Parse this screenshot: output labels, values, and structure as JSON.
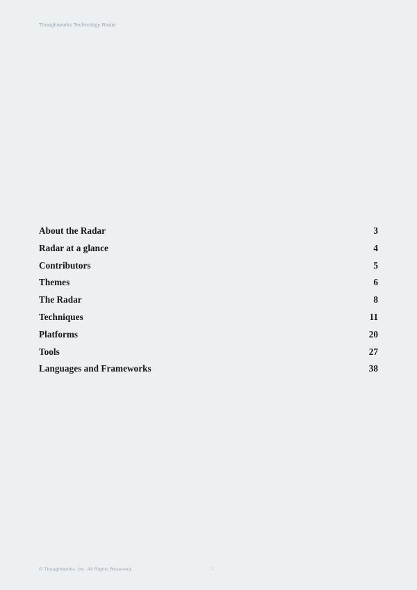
{
  "document": {
    "running_header": "Thoughtworks Technology Radar",
    "background_color": "#edf0f3",
    "text_color": "#13161a",
    "muted_color": "#9aa3ad"
  },
  "toc": {
    "entries": [
      {
        "title": "About the Radar",
        "page": "3"
      },
      {
        "title": "Radar at a glance",
        "page": "4"
      },
      {
        "title": "Contributors",
        "page": "5"
      },
      {
        "title": "Themes",
        "page": "6"
      },
      {
        "title": "The Radar",
        "page": "8"
      },
      {
        "title": "Techniques",
        "page": "11"
      },
      {
        "title": "Platforms",
        "page": "20"
      },
      {
        "title": "Tools",
        "page": "27"
      },
      {
        "title": "Languages and Frameworks",
        "page": "38"
      }
    ]
  },
  "footer": {
    "copyright": "© Thoughtworks, Inc. All Rights Reserved.",
    "page_number": "2"
  }
}
